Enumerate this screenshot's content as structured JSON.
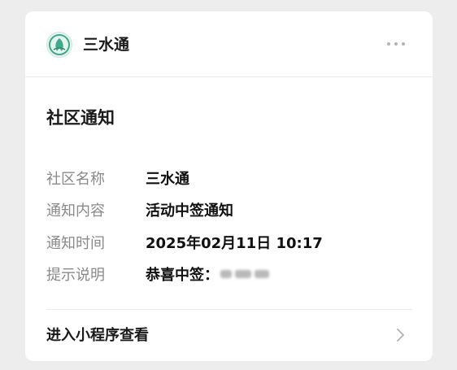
{
  "header": {
    "app_name": "三水通",
    "logo_icon": "sanshuitong-logo-icon",
    "more_icon": "more-horizontal-icon"
  },
  "notice": {
    "title": "社区通知",
    "fields": [
      {
        "label": "社区名称",
        "value": "三水通"
      },
      {
        "label": "通知内容",
        "value": "活动中签通知"
      },
      {
        "label": "通知时间",
        "value": "2025年02月11日 10:17"
      },
      {
        "label": "提示说明",
        "value": "恭喜中签："
      }
    ]
  },
  "footer": {
    "link_label": "进入小程序查看",
    "chevron_icon": "chevron-right-icon"
  },
  "colors": {
    "background": "#ededed",
    "card": "#ffffff",
    "label": "#8a8a8a",
    "logo_green": "#3fa98a"
  }
}
